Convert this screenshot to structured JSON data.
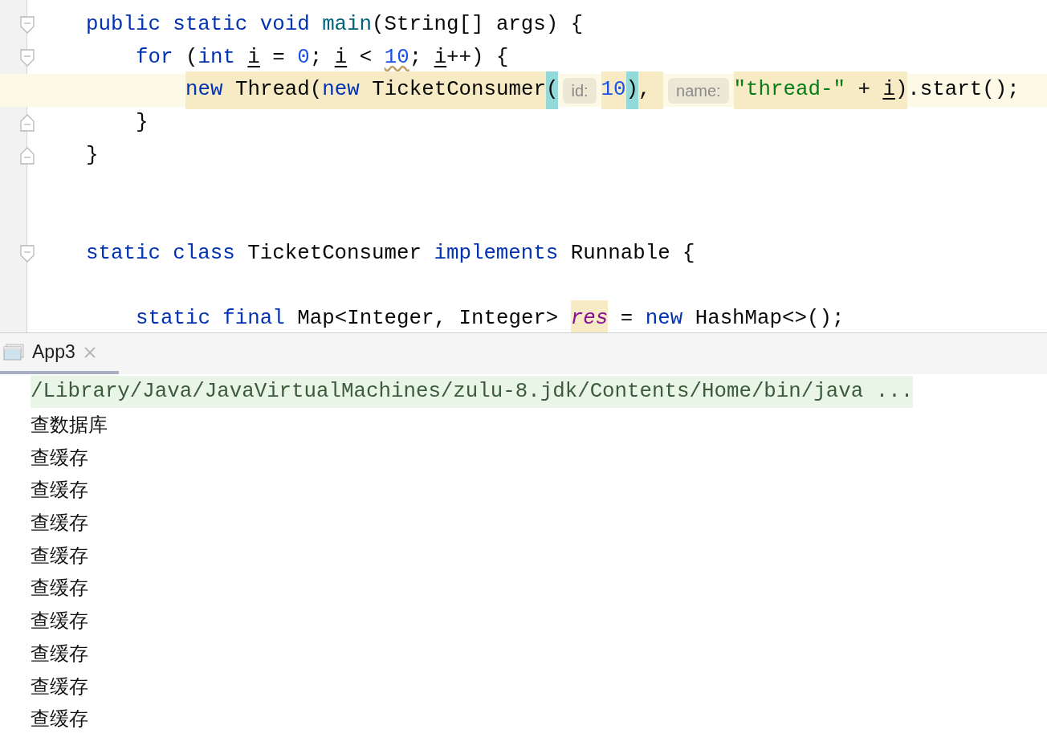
{
  "editor": {
    "lines": [
      {
        "kind": "code",
        "fold_open": true,
        "tokens": [
          {
            "text": "public static void ",
            "kind": "keyword"
          },
          {
            "text": "main",
            "kind": "method"
          },
          {
            "text": "(String[] args) {",
            "kind": "plain"
          }
        ],
        "children": [
          {
            "kind": "code",
            "fold_open": true,
            "tokens": [
              {
                "text": "for",
                "kind": "keyword"
              },
              {
                "text": " (",
                "kind": "plain"
              },
              {
                "text": "int ",
                "kind": "keyword"
              },
              {
                "text": "i",
                "kind": "var"
              },
              {
                "text": " = ",
                "kind": "plain"
              },
              {
                "text": "0",
                "kind": "number"
              },
              {
                "text": "; ",
                "kind": "plain"
              },
              {
                "text": "i",
                "kind": "var"
              },
              {
                "text": " < ",
                "kind": "plain"
              },
              {
                "text": "10",
                "kind": "number",
                "squiggly": true
              },
              {
                "text": "; ",
                "kind": "plain"
              },
              {
                "text": "i",
                "kind": "var"
              },
              {
                "text": "++) {",
                "kind": "plain"
              }
            ],
            "children": [
              {
                "kind": "code",
                "current": true,
                "tokens": [
                  {
                    "text": "new",
                    "kind": "keyword",
                    "marked": true
                  },
                  {
                    "text": " Thread(",
                    "kind": "plain",
                    "marked": true
                  },
                  {
                    "text": "new",
                    "kind": "keyword",
                    "marked": true
                  },
                  {
                    "text": " TicketConsumer",
                    "kind": "plain",
                    "marked": true
                  },
                  {
                    "text": "(",
                    "kind": "plain",
                    "marked": true,
                    "match": true
                  },
                  {
                    "text": "id:",
                    "kind": "hint"
                  },
                  {
                    "text": "10",
                    "kind": "number",
                    "marked": true
                  },
                  {
                    "text": ")",
                    "kind": "plain",
                    "marked": true,
                    "match": true
                  },
                  {
                    "text": ", ",
                    "kind": "plain",
                    "marked": true
                  },
                  {
                    "text": "name:",
                    "kind": "hint"
                  },
                  {
                    "text": "\"thread-\"",
                    "kind": "string",
                    "marked": true
                  },
                  {
                    "text": " + ",
                    "kind": "plain",
                    "marked": true
                  },
                  {
                    "text": "i",
                    "kind": "var",
                    "marked": true
                  },
                  {
                    "text": ")",
                    "kind": "plain",
                    "marked": true
                  },
                  {
                    "text": ".start();",
                    "kind": "plain"
                  }
                ]
              }
            ]
          },
          {
            "kind": "code",
            "fold_close": true,
            "tokens": [
              {
                "text": "}",
                "kind": "plain"
              }
            ]
          }
        ]
      },
      {
        "kind": "code",
        "fold_close": true,
        "tokens": [
          {
            "text": "}",
            "kind": "plain"
          }
        ]
      },
      {
        "kind": "blank"
      },
      {
        "kind": "blank"
      },
      {
        "kind": "code",
        "fold_open": true,
        "tokens": [
          {
            "text": "static class ",
            "kind": "keyword"
          },
          {
            "text": "TicketConsumer ",
            "kind": "plain"
          },
          {
            "text": "implements ",
            "kind": "keyword"
          },
          {
            "text": "Runnable {",
            "kind": "plain"
          }
        ],
        "children": [
          {
            "kind": "blank"
          },
          {
            "kind": "code",
            "tokens": [
              {
                "text": "static final ",
                "kind": "keyword"
              },
              {
                "text": "Map<Integer, Integer> ",
                "kind": "plain"
              },
              {
                "text": "res",
                "kind": "field",
                "marked": true
              },
              {
                "text": " = ",
                "kind": "plain"
              },
              {
                "text": "new ",
                "kind": "keyword"
              },
              {
                "text": "HashMap<>();",
                "kind": "plain"
              }
            ]
          }
        ]
      }
    ]
  },
  "run_panel": {
    "tabs": [
      {
        "label": "App3",
        "selected": true
      }
    ],
    "output": [
      {
        "text": "/Library/Java/JavaVirtualMachines/zulu-8.jdk/Contents/Home/bin/java ...",
        "kind": "command"
      },
      {
        "text": "查数据库",
        "kind": "stdout"
      },
      {
        "text": "查缓存",
        "kind": "stdout"
      },
      {
        "text": "查缓存",
        "kind": "stdout"
      },
      {
        "text": "查缓存",
        "kind": "stdout"
      },
      {
        "text": "查缓存",
        "kind": "stdout"
      },
      {
        "text": "查缓存",
        "kind": "stdout"
      },
      {
        "text": "查缓存",
        "kind": "stdout"
      },
      {
        "text": "查缓存",
        "kind": "stdout"
      },
      {
        "text": "查缓存",
        "kind": "stdout"
      },
      {
        "text": "查缓存",
        "kind": "stdout"
      }
    ]
  }
}
